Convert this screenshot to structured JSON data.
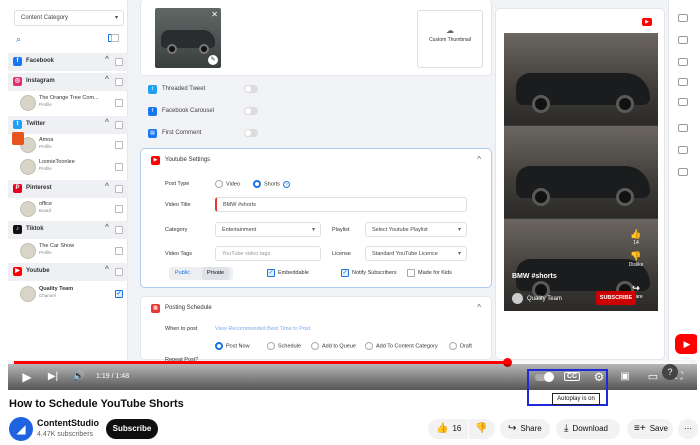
{
  "sidebar": {
    "category_placeholder": "Content Category",
    "groups": [
      {
        "name": "Facebook",
        "color": "#1877f2",
        "glyph": "f"
      },
      {
        "name": "Instagram",
        "color": "#e1306c",
        "glyph": "◎"
      },
      {
        "name": "Twitter",
        "color": "#1da1f2",
        "glyph": "t"
      },
      {
        "name": "Pinterest",
        "color": "#e60023",
        "glyph": "P"
      },
      {
        "name": "Tiktok",
        "color": "#111111",
        "glyph": "♪"
      },
      {
        "name": "Youtube",
        "color": "#ff0000",
        "glyph": "▶"
      }
    ],
    "accounts": [
      {
        "name": "The Orange Tree Com...",
        "type": "Profile"
      },
      {
        "name": "Amna",
        "type": "Profile"
      },
      {
        "name": "LoonieToonlee",
        "type": "Profile"
      },
      {
        "name": "office",
        "type": "Board"
      },
      {
        "name": "The Car Show",
        "type": "Profile"
      },
      {
        "name": "Quality Team",
        "type": "Channel"
      }
    ]
  },
  "composer": {
    "custom_thumbnail": "Custom Thumbnail",
    "options": [
      "Threaded Tweet",
      "Facebook Carousel",
      "First Comment"
    ],
    "youtube": {
      "title": "Youtube Settings",
      "post_type_label": "Post Type",
      "post_type_video": "Video",
      "post_type_shorts": "Shorts",
      "video_title_label": "Video Title",
      "video_title_value": "BMW #shorts",
      "category_label": "Category",
      "category_value": "Entertainment",
      "playlist_label": "Playlist",
      "playlist_placeholder": "Select Youtube Playlist",
      "tags_label": "Video Tags",
      "tags_placeholder": "YouTube video tags",
      "license_label": "License",
      "license_value": "Standard YouTube Licence",
      "public": "Public",
      "private": "Private",
      "embeddable": "Embeddable",
      "notify": "Notify Subscribers",
      "made_for_kids": "Made for Kids"
    },
    "posting": {
      "title": "Posting Schedule",
      "when_label": "When to post",
      "recommended": "View Recommended Best Time to Post",
      "choices": [
        "Post Now",
        "Schedule",
        "Add to Queue",
        "Add To Content Category",
        "Draft"
      ],
      "repeat": "Repeat Post?"
    }
  },
  "preview": {
    "video_title": "BMW #shorts",
    "channel": "Quality Team",
    "subscribe": "SUBSCRIBE",
    "likes": "14",
    "dislike": "Dislike",
    "share": "Share"
  },
  "player": {
    "time": "1:19 / 1:48",
    "progress": 0.73,
    "tooltip": "Autoplay is on",
    "cc": "CC"
  },
  "video": {
    "title": "How to Schedule YouTube Shorts",
    "channel": "ContentStudio",
    "subscribers": "4.47K subscribers",
    "subscribe": "Subscribe",
    "likes": "16",
    "share": "Share",
    "download": "Download",
    "save": "Save"
  }
}
